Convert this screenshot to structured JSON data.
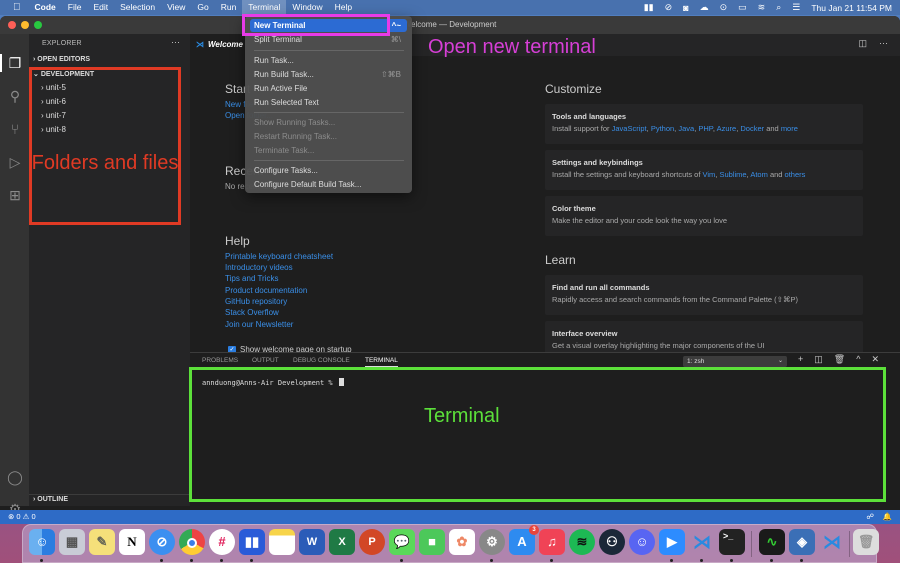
{
  "menubar": {
    "apple": "",
    "app": "Code",
    "items": [
      "File",
      "Edit",
      "Selection",
      "View",
      "Go",
      "Run",
      "Terminal",
      "Window",
      "Help"
    ],
    "active_item": "Terminal",
    "status_icons": [
      "vpn-icon",
      "focus-icon",
      "zoom-icon",
      "cloud-upload-icon",
      "play-icon",
      "battery-icon",
      "wifi-icon",
      "spotlight-icon",
      "control-center-icon"
    ],
    "datetime": "Thu Jan 21  11:54 PM"
  },
  "window": {
    "title": "Welcome — Development"
  },
  "sidebar": {
    "title": "EXPLORER",
    "more": "···",
    "open_editors": "OPEN EDITORS",
    "folder": "DEVELOPMENT",
    "items": [
      {
        "label": "unit-5"
      },
      {
        "label": "unit-6"
      },
      {
        "label": "unit-7"
      },
      {
        "label": "unit-8"
      }
    ],
    "outline": "OUTLINE"
  },
  "editor": {
    "tab": "Welcome",
    "start": {
      "heading": "Start",
      "links": [
        "New file",
        "Open folder..."
      ]
    },
    "recent": {
      "heading": "Recent",
      "text": "No recent folders"
    },
    "help": {
      "heading": "Help",
      "links": [
        "Printable keyboard cheatsheet",
        "Introductory videos",
        "Tips and Tricks",
        "Product documentation",
        "GitHub repository",
        "Stack Overflow",
        "Join our Newsletter"
      ]
    },
    "show_welcome": "Show welcome page on startup",
    "customize": {
      "heading": "Customize",
      "cards": [
        {
          "title": "Tools and languages",
          "prefix": "Install support for ",
          "links": [
            "JavaScript",
            "Python",
            "Java",
            "PHP",
            "Azure",
            "Docker"
          ],
          "suffix": " and ",
          "last": "more"
        },
        {
          "title": "Settings and keybindings",
          "prefix": "Install the settings and keyboard shortcuts of ",
          "links": [
            "Vim",
            "Sublime",
            "Atom"
          ],
          "suffix": " and ",
          "last": "others"
        },
        {
          "title": "Color theme",
          "desc": "Make the editor and your code look the way you love"
        }
      ]
    },
    "learn": {
      "heading": "Learn",
      "cards": [
        {
          "title": "Find and run all commands",
          "desc": "Rapidly access and search commands from the Command Palette (⇧⌘P)"
        },
        {
          "title": "Interface overview",
          "desc": "Get a visual overlay highlighting the major components of the UI"
        }
      ]
    }
  },
  "terminal_menu": {
    "items": [
      {
        "label": "New Terminal",
        "shortcut": "^~",
        "state": "highlighted"
      },
      {
        "label": "Split Terminal",
        "shortcut": "⌘\\",
        "state": "normal"
      },
      {
        "label": "Run Task...",
        "shortcut": "",
        "state": "normal"
      },
      {
        "label": "Run Build Task...",
        "shortcut": "⇧⌘B",
        "state": "normal"
      },
      {
        "label": "Run Active File",
        "shortcut": "",
        "state": "normal"
      },
      {
        "label": "Run Selected Text",
        "shortcut": "",
        "state": "normal"
      },
      {
        "label": "Show Running Tasks...",
        "shortcut": "",
        "state": "disabled"
      },
      {
        "label": "Restart Running Task...",
        "shortcut": "",
        "state": "disabled"
      },
      {
        "label": "Terminate Task...",
        "shortcut": "",
        "state": "disabled"
      },
      {
        "label": "Configure Tasks...",
        "shortcut": "",
        "state": "normal"
      },
      {
        "label": "Configure Default Build Task...",
        "shortcut": "",
        "state": "normal"
      }
    ]
  },
  "panel": {
    "tabs": [
      "PROBLEMS",
      "OUTPUT",
      "DEBUG CONSOLE",
      "TERMINAL"
    ],
    "active_tab": "TERMINAL",
    "shell_select": "1: zsh",
    "prompt": "annduong@Anns-Air Development % "
  },
  "statusbar": {
    "errors": "0",
    "warnings": "0"
  },
  "annotations": {
    "new_terminal": "Open new terminal",
    "folders": "Folders and files",
    "terminal": "Terminal"
  },
  "dock": {
    "apps": [
      "Finder",
      "Launchpad",
      "Stickies",
      "Notion",
      "Safari",
      "Chrome",
      "Slack",
      "Monday",
      "Notes",
      "Word",
      "Excel",
      "PowerPoint",
      "Messages",
      "FaceTime",
      "Photos",
      "System Preferences",
      "App Store",
      "Music",
      "Spotify",
      "Steam",
      "Discord",
      "Zoom",
      "VS Code",
      "Terminal",
      "Activity Monitor",
      "VirtualBox",
      "VS Code Insiders",
      "Trash"
    ],
    "app_store_badge": "3"
  },
  "colors": {
    "accent_blue": "#2e6bc6",
    "link": "#3a8fe8",
    "annotation_pink": "#e83be8",
    "annotation_red": "#e03a24",
    "annotation_green": "#5ce03a"
  }
}
